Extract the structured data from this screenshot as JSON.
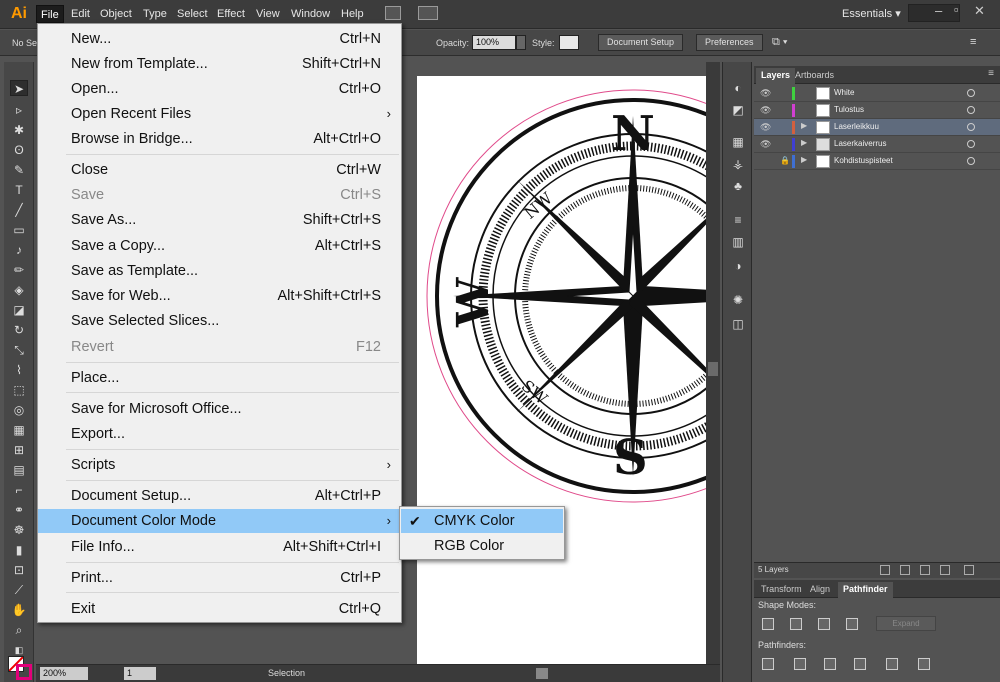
{
  "app": {
    "logo": "Ai"
  },
  "menubar": {
    "items": [
      "File",
      "Edit",
      "Object",
      "Type",
      "Select",
      "Effect",
      "View",
      "Window",
      "Help"
    ],
    "workspace": "Essentials"
  },
  "controlbar": {
    "selection_label": "No Se",
    "opacity_label": "Opacity:",
    "opacity_value": "100%",
    "style_label": "Style:",
    "document_setup": "Document Setup",
    "preferences": "Preferences"
  },
  "file_menu": {
    "items": [
      {
        "label": "New...",
        "shortcut": "Ctrl+N"
      },
      {
        "label": "New from Template...",
        "shortcut": "Shift+Ctrl+N"
      },
      {
        "label": "Open...",
        "shortcut": "Ctrl+O"
      },
      {
        "label": "Open Recent Files",
        "shortcut": ""
      },
      {
        "label": "Browse in Bridge...",
        "shortcut": "Alt+Ctrl+O"
      },
      {
        "label": "Close",
        "shortcut": "Ctrl+W"
      },
      {
        "label": "Save",
        "shortcut": "Ctrl+S"
      },
      {
        "label": "Save As...",
        "shortcut": "Shift+Ctrl+S"
      },
      {
        "label": "Save a Copy...",
        "shortcut": "Alt+Ctrl+S"
      },
      {
        "label": "Save as Template...",
        "shortcut": ""
      },
      {
        "label": "Save for Web...",
        "shortcut": "Alt+Shift+Ctrl+S"
      },
      {
        "label": "Save Selected Slices...",
        "shortcut": ""
      },
      {
        "label": "Revert",
        "shortcut": "F12"
      },
      {
        "label": "Place...",
        "shortcut": ""
      },
      {
        "label": "Save for Microsoft Office...",
        "shortcut": ""
      },
      {
        "label": "Export...",
        "shortcut": ""
      },
      {
        "label": "Scripts",
        "shortcut": ""
      },
      {
        "label": "Document Setup...",
        "shortcut": "Alt+Ctrl+P"
      },
      {
        "label": "Document Color Mode",
        "shortcut": ""
      },
      {
        "label": "File Info...",
        "shortcut": "Alt+Shift+Ctrl+I"
      },
      {
        "label": "Print...",
        "shortcut": "Ctrl+P"
      },
      {
        "label": "Exit",
        "shortcut": "Ctrl+Q"
      }
    ]
  },
  "color_mode_submenu": {
    "items": [
      {
        "label": "CMYK Color",
        "checked": true
      },
      {
        "label": "RGB Color",
        "checked": false
      }
    ]
  },
  "artwork": {
    "labels": [
      "N",
      "S",
      "W",
      "NW",
      "SW"
    ]
  },
  "layers_panel": {
    "tabs": [
      "Layers",
      "Artboards"
    ],
    "layers": [
      {
        "name": "White",
        "color": "#3fd13f"
      },
      {
        "name": "Tulostus",
        "color": "#d23fd2"
      },
      {
        "name": "Laserleikkuu",
        "color": "#d2603f"
      },
      {
        "name": "Laserkaiverrus",
        "color": "#3f3fd2"
      },
      {
        "name": "Kohdistuspisteet",
        "color": "#3f6fd2"
      }
    ],
    "count": "5 Layers"
  },
  "pathfinder_panel": {
    "tabs": [
      "Transform",
      "Align",
      "Pathfinder"
    ],
    "shape_modes_label": "Shape Modes:",
    "expand_label": "Expand",
    "pathfinders_label": "Pathfinders:"
  },
  "statusbar": {
    "zoom": "200%",
    "page": "1",
    "tool": "Selection"
  }
}
